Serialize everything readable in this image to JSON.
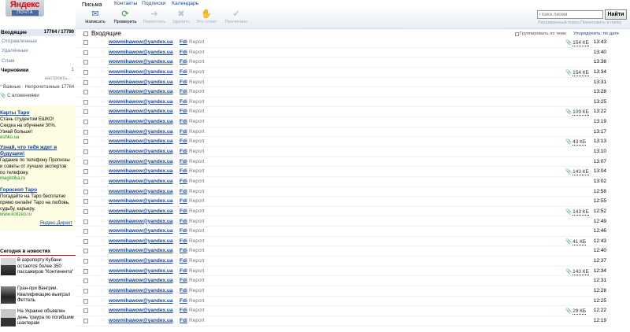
{
  "logo": {
    "brand": "Яндекс",
    "service": "ПОЧТА"
  },
  "sidebar": {
    "inbox": {
      "label": "Входящие",
      "count": "17764 / 17790"
    },
    "folders": [
      "Отправленные",
      "Удалённые",
      "Спам"
    ],
    "drafts": {
      "label": "Черновики",
      "count": "1"
    },
    "setup": "настроить...",
    "flag_star": "*",
    "flags": "Важные · Непрочитанные 17764",
    "attachments": "С вложениями"
  },
  "ads": [
    {
      "title": "Карты Таро",
      "lines": [
        "Стань студентом ЕШКО!",
        "Скидка на обучение 30%.",
        "Узнай больше!"
      ],
      "url": "eshko.ua"
    },
    {
      "title": "Узнай, что тебя ждет в будущем!",
      "lines": [
        "Гадание по телефону Прогнозы",
        "и советы от лучших экспертов",
        "по телефону."
      ],
      "url": "magistika.ru"
    },
    {
      "title": "Гороскоп Таро",
      "lines": [
        "Погадайте на Таро бесплатно",
        "прямо онлайн! Таро на любовь,",
        "судьбу, карьеру."
      ],
      "url": "www.kolizeo.ru"
    }
  ],
  "direct": "Яндекс.Директ",
  "news": {
    "heading": "Сегодня в новостях",
    "items": [
      {
        "text": "В аэропорту Кубани остаются более 350 пассажиров \"Континента\""
      },
      {
        "text": "Гран-при Венгрии. Квалификацию выиграл Феттель"
      },
      {
        "text": "На Украине объявлен день траура по погибшим шахтерам"
      }
    ]
  },
  "tabs": [
    "Письма",
    "Контакты",
    "Подписки",
    "Календарь"
  ],
  "toolbar": {
    "write": "Написать",
    "check": "Проверить",
    "forward": "Переслать",
    "delete": "Удалить",
    "spam": "Это спам!",
    "read": "Прочитано"
  },
  "search": {
    "placeholder": "Поиск писем",
    "button": "Найти",
    "advanced": "Расширенный поиск",
    "move": "Переложить в папку"
  },
  "list": {
    "title": "Входящие",
    "group_by_thread": "Группировать по теме",
    "sort": "Упорядочить: по дате"
  },
  "message_defaults": {
    "sender": "wowmihawow@yandex.ua",
    "fwd": "Fdi",
    "subject": "Report"
  },
  "messages": [
    {
      "time": "13:43",
      "attach": "154 КБ"
    },
    {
      "time": "13:40"
    },
    {
      "time": "13:38"
    },
    {
      "time": "13:34",
      "attach": "154 КБ"
    },
    {
      "time": "13:31"
    },
    {
      "time": "13:28"
    },
    {
      "time": "13:25"
    },
    {
      "time": "13:22",
      "attach": "109 КБ"
    },
    {
      "time": "13:19"
    },
    {
      "time": "13:17"
    },
    {
      "time": "13:13",
      "attach": "43 КБ"
    },
    {
      "time": "13:10"
    },
    {
      "time": "13:07"
    },
    {
      "time": "13:04",
      "attach": "143 КБ"
    },
    {
      "time": "13:02"
    },
    {
      "time": "12:58"
    },
    {
      "time": "12:55"
    },
    {
      "time": "12:52",
      "attach": "143 КБ"
    },
    {
      "time": "12:49"
    },
    {
      "time": "12:46"
    },
    {
      "time": "12:43",
      "attach": "41 КБ"
    },
    {
      "time": "12:40"
    },
    {
      "time": "12:37"
    },
    {
      "time": "12:34",
      "attach": "143 КБ"
    },
    {
      "time": "12:31"
    },
    {
      "time": "12:28"
    },
    {
      "time": "12:25"
    },
    {
      "time": "12:22",
      "attach": "29 КБ"
    },
    {
      "time": "12:19"
    }
  ],
  "icons": {
    "write": "envelope-pen-icon",
    "check": "refresh-icon",
    "forward": "arrow-right-icon",
    "delete": "x-icon",
    "spam": "thumb-down-icon",
    "read": "checkmark-icon",
    "flag": "flag-icon",
    "attach": "paperclip-icon"
  },
  "colors": {
    "link": "#1844a0",
    "brand_red": "#e8000b",
    "ad_bg": "#fdfde3",
    "inbox_bg": "#e2e8f1"
  }
}
